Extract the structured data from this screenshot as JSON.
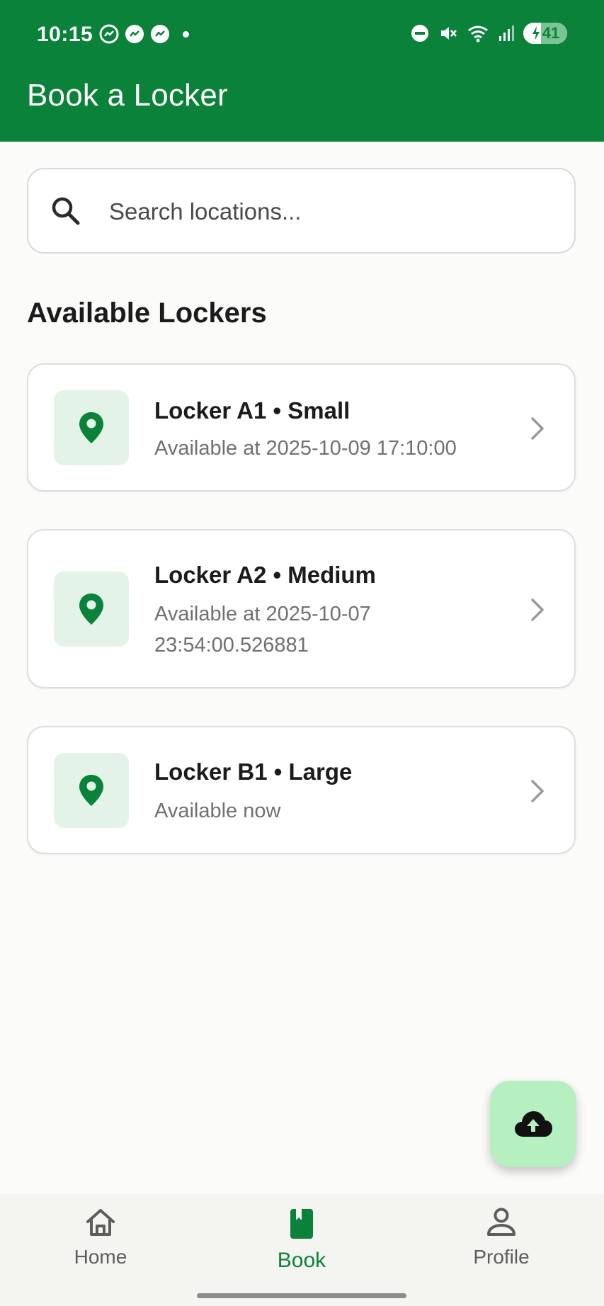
{
  "status_bar": {
    "time": "10:15",
    "battery": "41",
    "notification_icons": [
      "messenger-icon",
      "messenger-icon",
      "messenger-icon"
    ],
    "system_icons": [
      "do-not-disturb-icon",
      "mute-icon",
      "wifi-icon",
      "signal-icon",
      "battery-charging-icon"
    ]
  },
  "app_bar": {
    "title": "Book a Locker"
  },
  "search": {
    "placeholder": "Search locations..."
  },
  "section": {
    "title": "Available Lockers"
  },
  "lockers": [
    {
      "title": "Locker A1 • Small",
      "subtitle": "Available at 2025-10-09 17:10:00"
    },
    {
      "title": "Locker A2 • Medium",
      "subtitle": "Available at 2025-10-07 23:54:00.526881"
    },
    {
      "title": "Locker B1 • Large",
      "subtitle": "Available now"
    }
  ],
  "fab": {
    "icon": "cloud-upload-icon"
  },
  "bottom_nav": {
    "items": [
      {
        "label": "Home",
        "icon": "home-icon",
        "active": false
      },
      {
        "label": "Book",
        "icon": "book-icon",
        "active": true
      },
      {
        "label": "Profile",
        "icon": "person-icon",
        "active": false
      }
    ]
  },
  "colors": {
    "primary": "#0a8239",
    "icon_bg": "#e4f3e8",
    "fab_bg": "#b6efc0",
    "nav_bg": "#f4f5f1"
  }
}
